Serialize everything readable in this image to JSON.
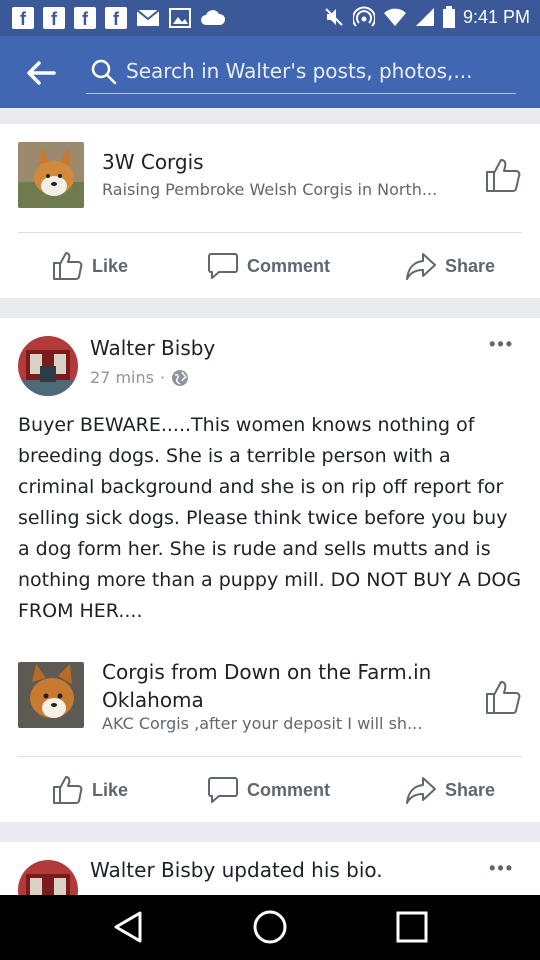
{
  "status_bar": {
    "time": "9:41 PM",
    "icons": [
      "facebook-notification-icon",
      "facebook-notification-icon",
      "facebook-notification-icon",
      "facebook-notification-icon",
      "mail-icon",
      "photo-icon",
      "cloud-icon"
    ],
    "right_icons": [
      "mute-icon",
      "hotspot-icon",
      "wifi-icon",
      "signal-icon",
      "battery-icon"
    ]
  },
  "search": {
    "placeholder": "Search in Walter's posts, photos,..."
  },
  "posts": [
    {
      "shared": {
        "title": "3W Corgis",
        "subtitle": "Raising Pembroke Welsh Corgis in North..."
      },
      "actions": {
        "like": "Like",
        "comment": "Comment",
        "share": "Share"
      }
    },
    {
      "author": "Walter Bisby",
      "time": "27 mins",
      "privacy_icon": "globe-icon",
      "text": "Buyer BEWARE.....This women knows nothing of breeding dogs. She is a terrible person with a criminal background and she is on rip off report for selling sick dogs. Please think twice before you buy a dog form her. She is rude and sells mutts and is nothing more than a puppy mill. DO NOT BUY A DOG FROM HER....",
      "shared": {
        "title": "Corgis from Down on the Farm.in Oklahoma",
        "subtitle": "AKC Corgis  ,after your deposit I will sh..."
      },
      "actions": {
        "like": "Like",
        "comment": "Comment",
        "share": "Share"
      }
    },
    {
      "author_line": "Walter Bisby updated his bio."
    }
  ],
  "colors": {
    "brand_blue": "#4267b2",
    "status_blue": "#3b5998",
    "action_gray": "#606770"
  }
}
